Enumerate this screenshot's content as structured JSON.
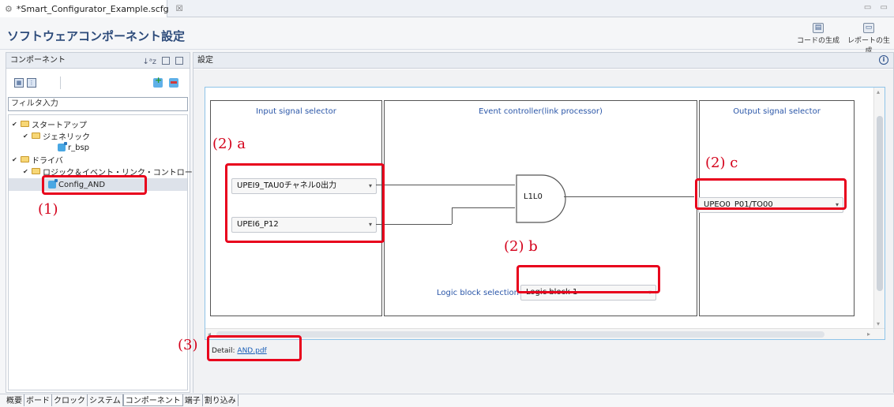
{
  "editor_tab": {
    "title": "*Smart_Configurator_Example.scfg",
    "close": "☒"
  },
  "header": {
    "title": "ソフトウェアコンポーネント設定",
    "generate_code": "コードの生成",
    "generate_report": "レポートの生成"
  },
  "components_pane": {
    "title": "コンポーネント",
    "filter_placeholder": "フィルタ入力",
    "tree": [
      {
        "label": "スタートアップ"
      },
      {
        "label": "ジェネリック"
      },
      {
        "label": "r_bsp"
      },
      {
        "label": "ドライバ"
      },
      {
        "label": "ロジック＆イベント・リンク・コントローラ"
      },
      {
        "label": "Config_AND"
      }
    ]
  },
  "settings_pane": {
    "title": "設定",
    "input_selector_title": "Input signal selector",
    "event_controller_title": "Event controller(link processor)",
    "output_selector_title": "Output signal selector",
    "input1_value": "UPEI9_TAU0チャネル0出力",
    "input2_value": "UPEI6_P12",
    "gate_label": "L1L0",
    "output_value": "UPEO0_P01/TO00",
    "logic_block_label": "Logic block selection",
    "logic_block_value": "Logic block 1",
    "detail_label": "Detail:",
    "detail_link": "AND.pdf"
  },
  "annotations": {
    "a1": "(1)",
    "a2a": "(2) a",
    "a2b": "(2) b",
    "a2c": "(2) c",
    "a3": "(3)"
  },
  "bottom_tabs": [
    "概要",
    "ボード",
    "クロック",
    "システム",
    "コンポーネント",
    "端子",
    "割り込み"
  ],
  "colors": {
    "annotation_red": "#e8001c",
    "title_blue": "#2a56a8"
  }
}
